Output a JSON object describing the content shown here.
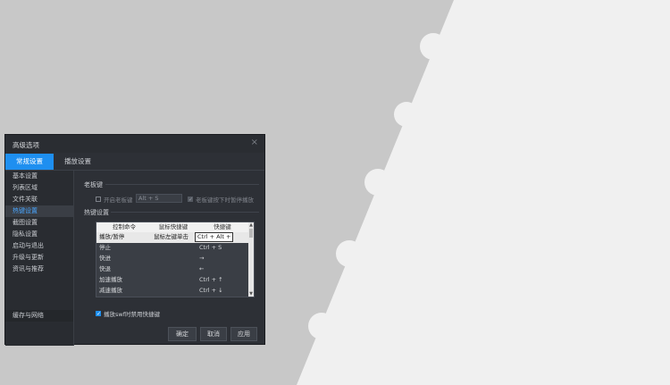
{
  "background": {
    "left_color": "#c8c8c8",
    "right_color": "#f0f0f0"
  },
  "dialog": {
    "title": "高级选项",
    "close_glyph": "×",
    "tabs": [
      {
        "label": "常规设置",
        "active": true
      },
      {
        "label": "播放设置",
        "active": false
      }
    ],
    "sidebar": {
      "items": [
        "基本设置",
        "列表区域",
        "文件关联",
        "热键设置",
        "截图设置",
        "隐私设置",
        "启动与退出",
        "升级与更新",
        "资讯与推荐"
      ],
      "selected_index": 3,
      "bottom_item": "缓存与网络"
    },
    "boss_key": {
      "section": "老板键",
      "enable_label": "开启老板键",
      "enable_checked": false,
      "key_value": "Alt + S",
      "pause_label": "老板键按下时暂停播放",
      "pause_checked": true
    },
    "hotkeys": {
      "section": "热键设置",
      "headers": [
        "控制命令",
        "鼠标快捷键",
        "快捷键"
      ],
      "rows": [
        {
          "command": "播放/暂停",
          "mouse": "鼠标左键单击",
          "key": "Ctrl + Alt +"
        },
        {
          "command": "停止",
          "mouse": "",
          "key": "Ctrl + S"
        },
        {
          "command": "快进",
          "mouse": "",
          "key": "→"
        },
        {
          "command": "快退",
          "mouse": "",
          "key": "←"
        },
        {
          "command": "加速播放",
          "mouse": "",
          "key": "Ctrl + ↑"
        },
        {
          "command": "减速播放",
          "mouse": "",
          "key": "Ctrl + ↓"
        }
      ],
      "disable_swf_label": "播放swf时禁用快捷键",
      "disable_swf_checked": true
    },
    "buttons": {
      "ok": "确定",
      "cancel": "取消",
      "apply": "应用"
    }
  }
}
